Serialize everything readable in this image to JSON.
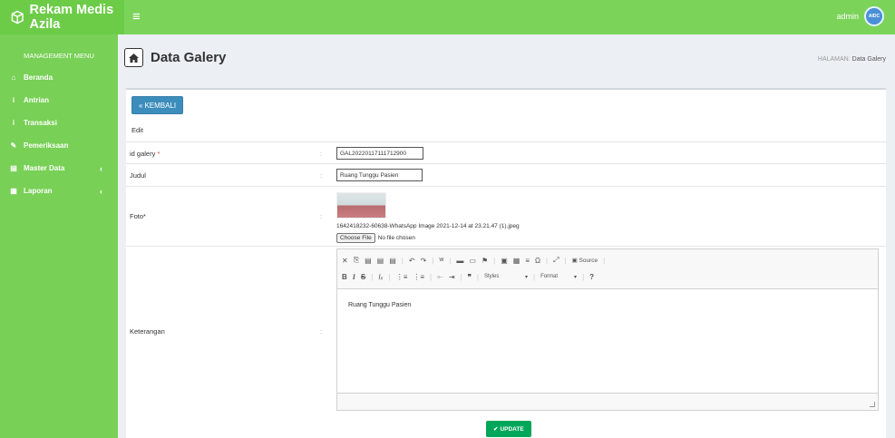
{
  "app": {
    "brand": "Rekam Medis Azila",
    "brand_icon": "cube-icon"
  },
  "topbar": {
    "menu_icon": "≡",
    "user_name": "admin",
    "avatar_text": "AIDC"
  },
  "sidebar": {
    "header": "MANAGEMENT MENU",
    "items": [
      {
        "label": "Beranda",
        "icon": "home-icon",
        "glyph": "⌂"
      },
      {
        "label": "Antrian",
        "icon": "info-icon",
        "glyph": "i"
      },
      {
        "label": "Transaksi",
        "icon": "info-icon",
        "glyph": "i"
      },
      {
        "label": "Pemeriksaan",
        "icon": "edit-icon",
        "glyph": "✎"
      },
      {
        "label": "Master Data",
        "icon": "database-icon",
        "glyph": "▤",
        "chevron": "‹"
      },
      {
        "label": "Laporan",
        "icon": "calendar-icon",
        "glyph": "▦",
        "chevron": "‹"
      }
    ]
  },
  "page": {
    "title": "Data Galery",
    "breadcrumb_label": "HALAMAN:",
    "breadcrumb_value": "Data Galery"
  },
  "form": {
    "back_label": "KEMBALI",
    "mode": "Edit",
    "fields": {
      "id_label": "id galery",
      "id_required": "*",
      "id_value": "GAL20220117111712900",
      "judul_label": "Judul",
      "judul_value": "Ruang Tunggu Pasien",
      "foto_label": "Foto*",
      "foto_filename": "1642418232-60638-WhatsApp Image 2021-12-14 at 23.21.47 (1).jpeg",
      "choose_label": "Choose File",
      "no_file": "No file chosen",
      "keterangan_label": "Keterangan",
      "keterangan_value": "Ruang Tunggu Pasien"
    },
    "colon": ":",
    "update_label": "UPDATE"
  },
  "editor": {
    "toolbar_row1": [
      "✕",
      "⎘",
      "▤",
      "▤",
      "▤",
      "|",
      "↶",
      "↷",
      "|",
      "ᵂ",
      "|",
      "▬",
      "▭",
      "⚑",
      "|",
      "▣",
      "▦",
      "≡",
      "Ω",
      "|",
      "⤢",
      "|",
      "▣ Source",
      "|"
    ],
    "toolbar_row2": [
      "B",
      "I",
      "S",
      "|",
      "Iₓ",
      "|",
      "⋮≡",
      "⋮≡",
      "|",
      "⇤",
      "⇥",
      "|",
      "❞",
      "|"
    ],
    "styles_label": "Styles",
    "format_label": "Format",
    "help": "?"
  },
  "colors": {
    "green": "#7cd35a",
    "brand_green": "#6ccc48",
    "blue": "#3c8dbc",
    "update_green": "#00a65a"
  }
}
